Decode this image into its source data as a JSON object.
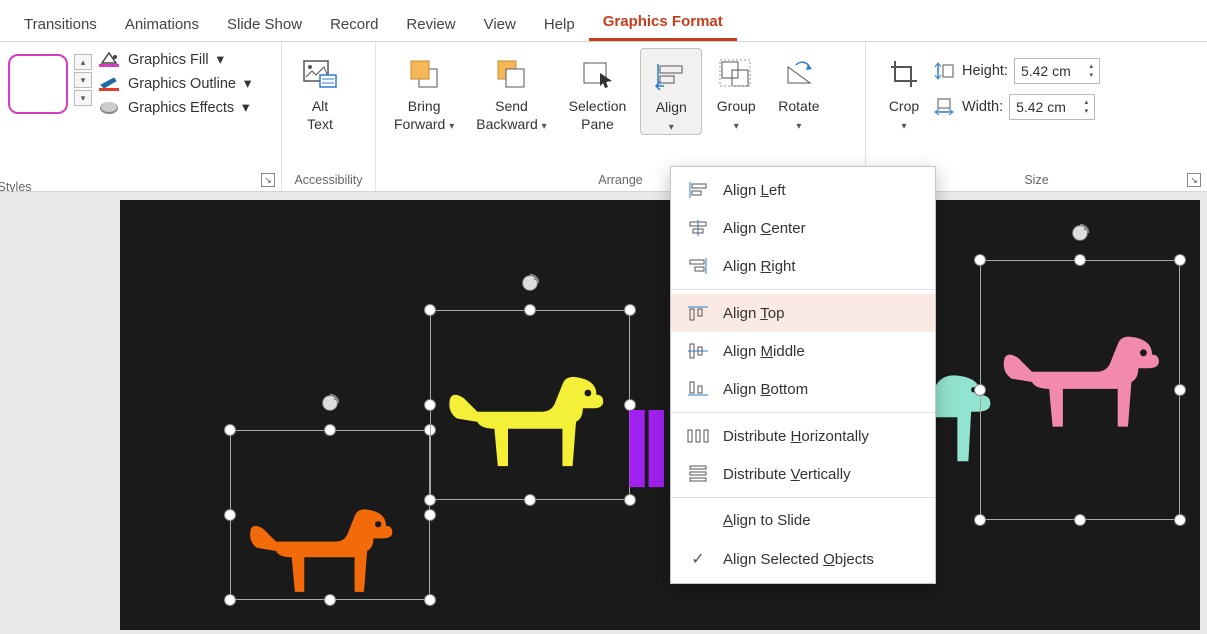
{
  "tabs": {
    "transitions": "Transitions",
    "animations": "Animations",
    "slideshow": "Slide Show",
    "record": "Record",
    "review": "Review",
    "view": "View",
    "help": "Help",
    "graphics_format": "Graphics Format"
  },
  "format": {
    "fill": "Graphics Fill",
    "outline": "Graphics Outline",
    "effects": "Graphics Effects"
  },
  "buttons": {
    "alt_text_l1": "Alt",
    "alt_text_l2": "Text",
    "bring_l1": "Bring",
    "bring_l2": "Forward",
    "send_l1": "Send",
    "send_l2": "Backward",
    "selection_l1": "Selection",
    "selection_l2": "Pane",
    "align": "Align",
    "group": "Group",
    "rotate": "Rotate",
    "crop": "Crop"
  },
  "size": {
    "height_label": "Height:",
    "height_val": "5.42 cm",
    "width_label": "Width:",
    "width_val": "5.42 cm"
  },
  "groups": {
    "styles": "Graphics Styles",
    "accessibility": "Accessibility",
    "arrange": "Arrange",
    "size": "Size"
  },
  "menu": {
    "left": "Align Left",
    "center": "Align Center",
    "right": "Align Right",
    "top": "Align Top",
    "middle": "Align Middle",
    "bottom": "Align Bottom",
    "dist_h": "Distribute Horizontally",
    "dist_v": "Distribute Vertically",
    "to_slide": "Align to Slide",
    "selected": "Align Selected Objects"
  },
  "colors": {
    "dog1": "#f26a0a",
    "dog2": "#f4f037",
    "dog3": "#a020f0",
    "dog4": "#92e3cf",
    "dog5": "#f18aac"
  }
}
